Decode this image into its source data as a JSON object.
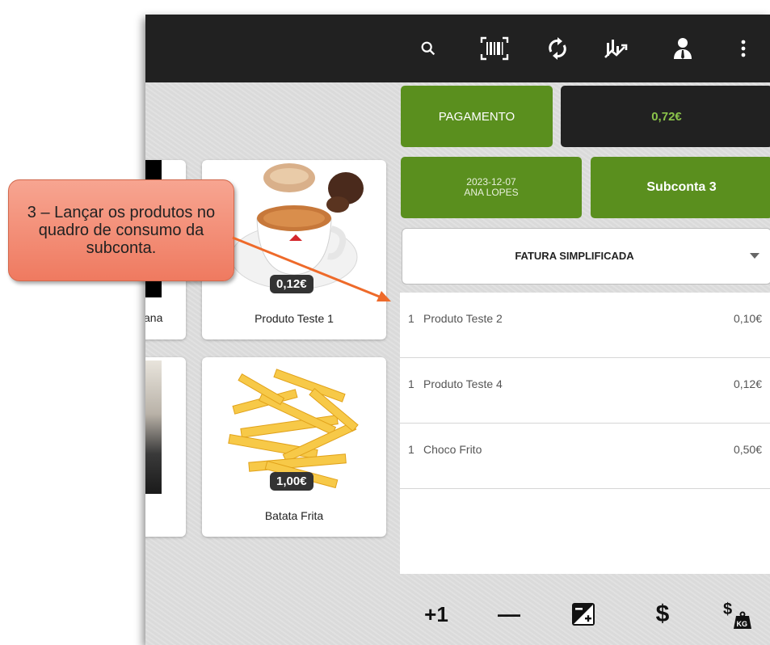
{
  "toolbar": {
    "icons": [
      "search-icon",
      "barcode-icon",
      "sync-icon",
      "chart-icon",
      "user-icon",
      "more-vert-icon"
    ]
  },
  "header": {
    "payment_label": "PAGAMENTO",
    "total": "0,72€",
    "date": "2023-12-07",
    "operator": "ANA LOPES",
    "subaccount_label": "Subconta 3",
    "doc_type": "FATURA SIMPLIFICADA"
  },
  "products": [
    {
      "name": "Produto Teste 1",
      "price": "0,12€"
    },
    {
      "name": "Batata Frita",
      "price": "1,00€"
    },
    {
      "name_partial": "ana"
    }
  ],
  "order_lines": [
    {
      "qty": "1",
      "name": "Produto Teste 2",
      "price": "0,10€"
    },
    {
      "qty": "1",
      "name": "Produto Teste 4",
      "price": "0,12€"
    },
    {
      "qty": "1",
      "name": "Choco Frito",
      "price": "0,50€"
    }
  ],
  "bottom_bar": {
    "plus_one": "+1",
    "minus": "—",
    "dollar": "$"
  },
  "callout": {
    "text": "3 – Lançar os produtos no quadro de consumo da subconta."
  },
  "colors": {
    "green": "#5a8f1e",
    "total_green": "#8bc34a",
    "topbar": "#212121",
    "callout": "#ef7a60"
  }
}
